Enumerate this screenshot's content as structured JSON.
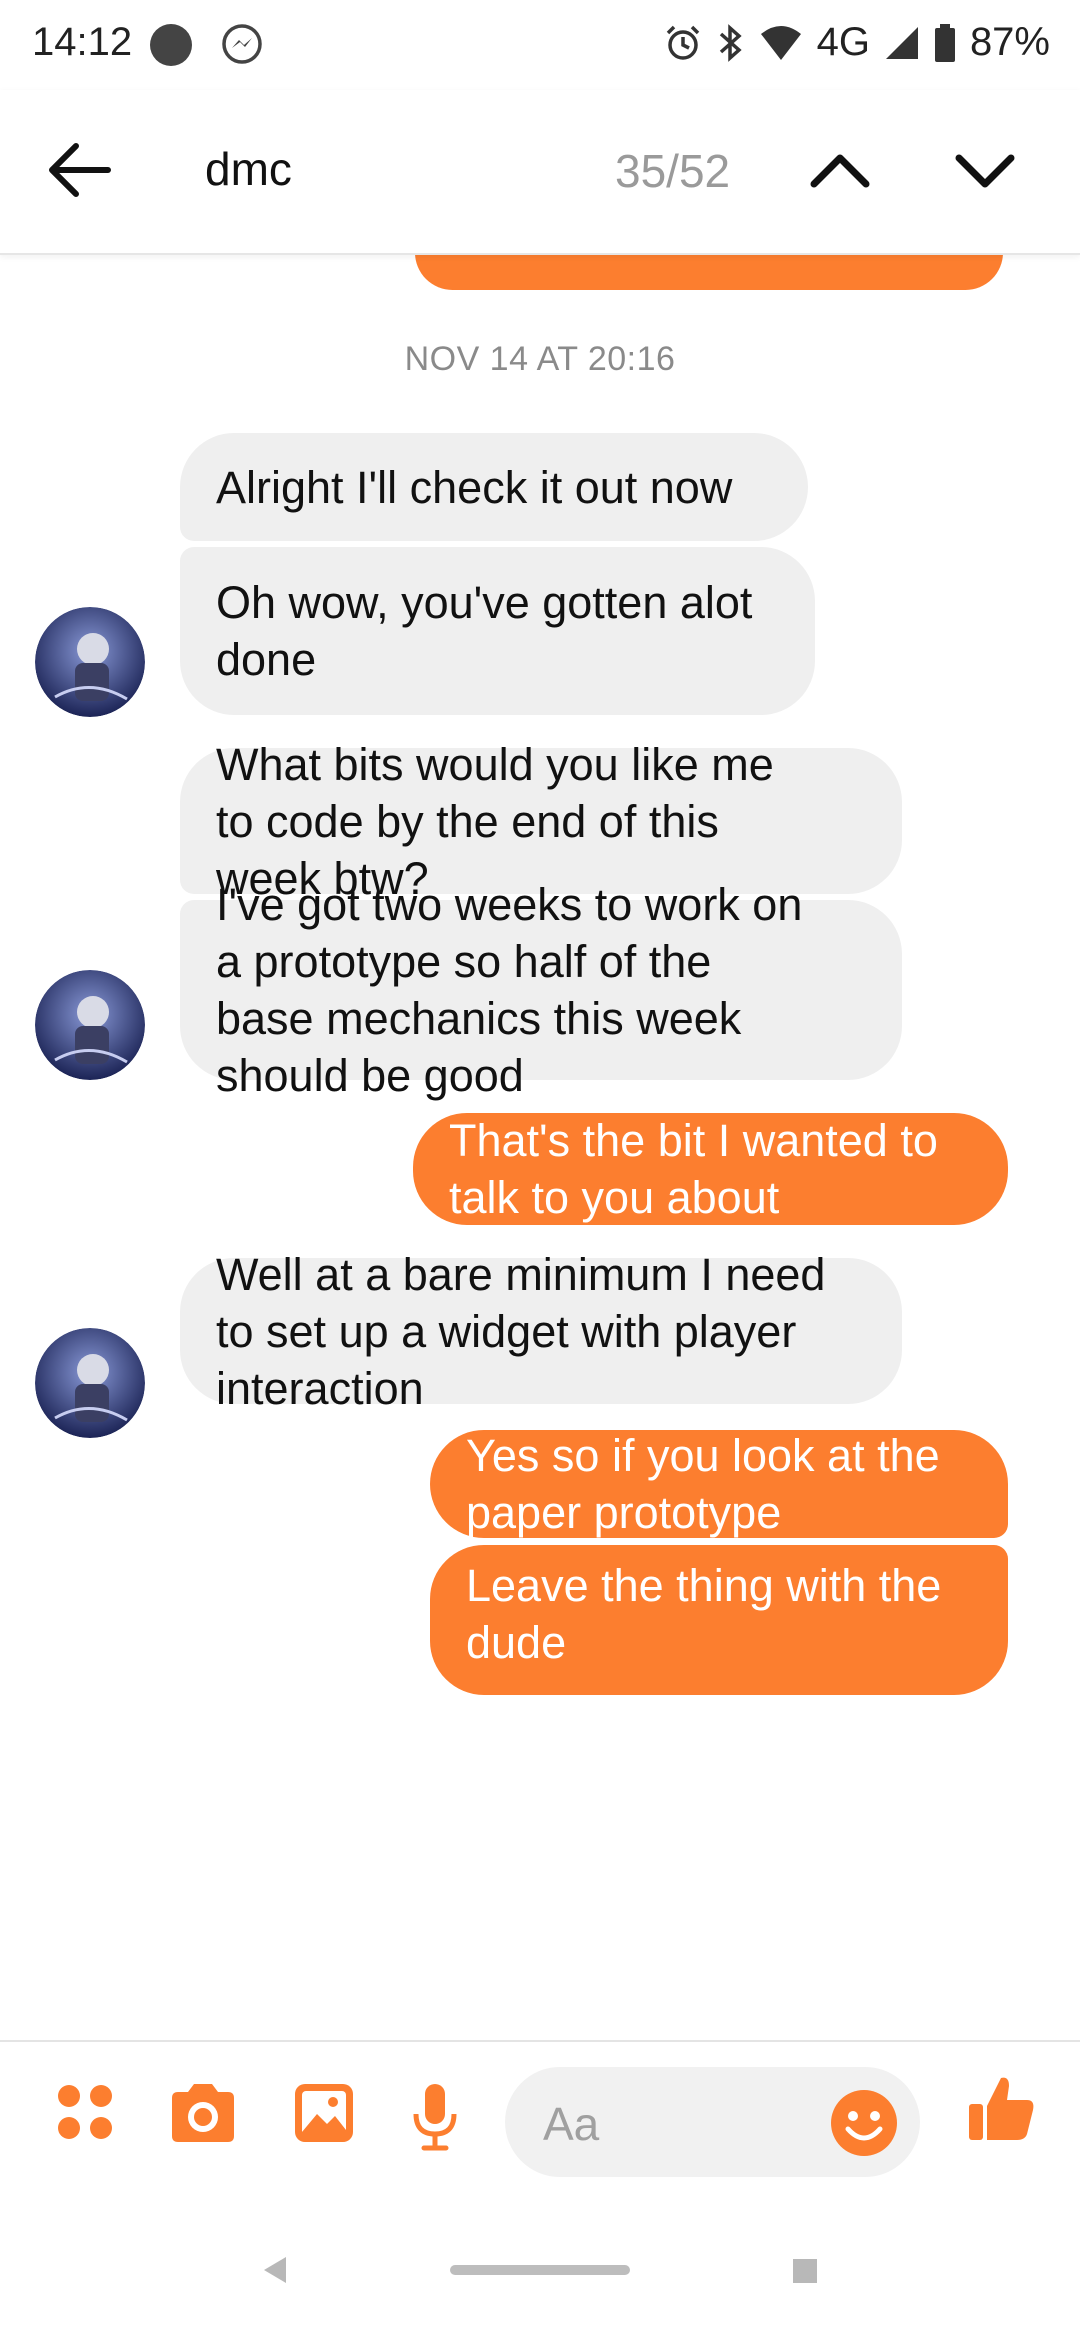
{
  "status_bar": {
    "time": "14:12",
    "network": "4G",
    "battery": "87%"
  },
  "header": {
    "search_query": "dmc",
    "match_counter": "35/52"
  },
  "thread": {
    "timestamp": "NOV 14 AT 20:16",
    "messages": [
      {
        "direction": "incoming",
        "lines": [
          "Alright I'll check it out now"
        ]
      },
      {
        "direction": "incoming",
        "lines": [
          "Oh wow, you've gotten alot",
          "done"
        ]
      },
      {
        "direction": "incoming",
        "lines": [
          "What bits would you like me",
          "to code by the end of this",
          "week btw?"
        ]
      },
      {
        "direction": "incoming",
        "lines": [
          "I've got two weeks to work on",
          "a prototype so half of the",
          "base mechanics this week",
          "should be good"
        ]
      },
      {
        "direction": "outgoing",
        "lines": [
          "That's the bit I wanted to",
          "talk to you about"
        ]
      },
      {
        "direction": "incoming",
        "lines": [
          "Well at a bare minimum I need",
          "to set up a widget with player",
          "interaction"
        ]
      },
      {
        "direction": "outgoing",
        "lines": [
          "Yes so if you look at the",
          "paper prototype"
        ]
      },
      {
        "direction": "outgoing",
        "lines": [
          "Leave the thing with the",
          "dude"
        ]
      }
    ]
  },
  "composer": {
    "placeholder": "Aa",
    "icons": [
      "apps-icon",
      "camera-icon",
      "gallery-icon",
      "microphone-icon",
      "emoji-icon",
      "thumbs-up-icon"
    ]
  },
  "colors": {
    "accent": "#fc7e2f",
    "incoming_bubble": "#efefef",
    "outgoing_text": "#ffffff"
  }
}
